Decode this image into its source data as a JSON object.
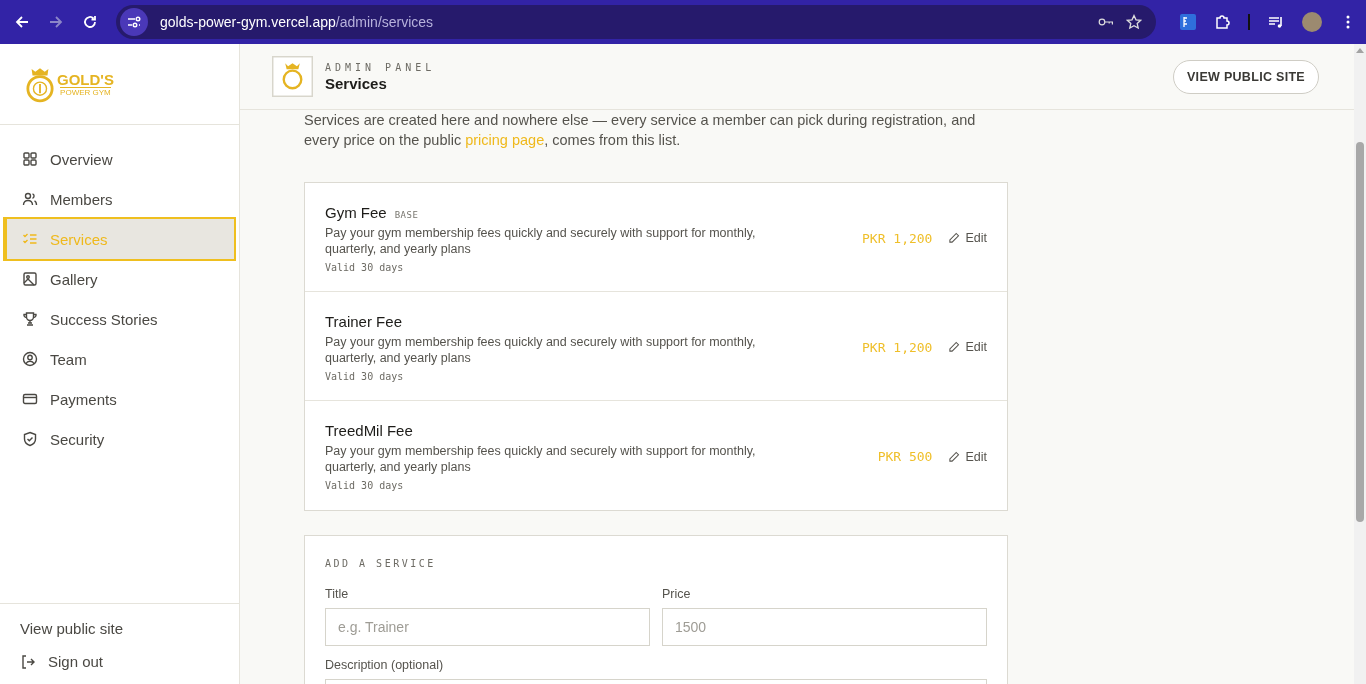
{
  "browser": {
    "url_host": "golds-power-gym.vercel.app",
    "url_path": "/admin/services"
  },
  "sidebar": {
    "logo": {
      "name": "GOLD'S",
      "tagline": "POWER GYM"
    },
    "items": [
      {
        "label": "Overview",
        "selected": false
      },
      {
        "label": "Members",
        "selected": false
      },
      {
        "label": "Services",
        "selected": true
      },
      {
        "label": "Gallery",
        "selected": false
      },
      {
        "label": "Success Stories",
        "selected": false
      },
      {
        "label": "Team",
        "selected": false
      },
      {
        "label": "Payments",
        "selected": false
      },
      {
        "label": "Security",
        "selected": false
      }
    ],
    "footer": {
      "view_site": "View public site",
      "sign_out": "Sign out"
    }
  },
  "header": {
    "eyebrow": "ADMIN PANEL",
    "title": "Services",
    "button": "VIEW PUBLIC SITE"
  },
  "intro": {
    "before": "Services are created here and nowhere else — every service a member can pick during registration, and every price on the public ",
    "link": "pricing page",
    "after": ", comes from this list."
  },
  "services": [
    {
      "title": "Gym Fee",
      "badge": "BASE",
      "description": "Pay your gym membership fees quickly and securely with support for monthly, quarterly, and yearly plans",
      "validity": "Valid 30 days",
      "price": "PKR 1,200",
      "action": "Edit"
    },
    {
      "title": "Trainer Fee",
      "description": "Pay your gym membership fees quickly and securely with support for monthly, quarterly, and yearly plans",
      "validity": "Valid 30 days",
      "price": "PKR 1,200",
      "action": "Edit"
    },
    {
      "title": "TreedMil Fee",
      "description": "Pay your gym membership fees quickly and securely with support for monthly, quarterly, and yearly plans",
      "validity": "Valid 30 days",
      "price": "PKR 500",
      "action": "Edit"
    }
  ],
  "add_form": {
    "heading": "ADD A SERVICE",
    "fields": [
      {
        "label": "Title",
        "placeholder": "e.g. Trainer"
      },
      {
        "label": "Price",
        "placeholder": "1500"
      }
    ],
    "description_label": "Description (optional)"
  }
}
